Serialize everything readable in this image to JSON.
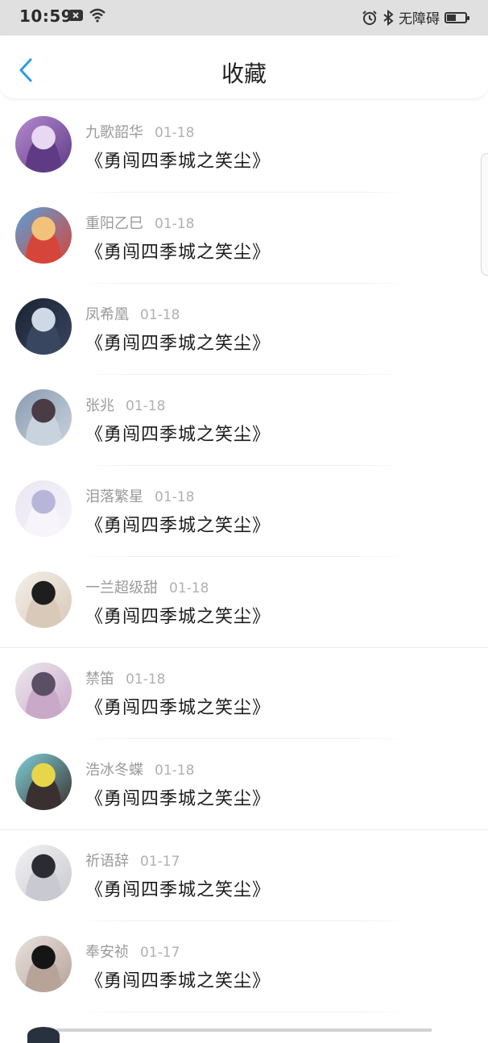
{
  "status_bar": {
    "time": "10:59",
    "right_label": "无障碍"
  },
  "header": {
    "title": "收藏",
    "back_icon": "chevron-left-icon",
    "accent_color": "#2b9ae6"
  },
  "items": [
    {
      "name": "九歌韶华",
      "date": "01-18",
      "title": "《勇闯四季城之笑尘》",
      "avatar": {
        "colors": [
          "#b58ad0",
          "#e8d8f2",
          "#5e3b84"
        ]
      }
    },
    {
      "name": "重阳乙巳",
      "date": "01-18",
      "title": "《勇闯四季城之笑尘》",
      "avatar": {
        "colors": [
          "#5aa0d8",
          "#f2c27a",
          "#d6453a"
        ]
      }
    },
    {
      "name": "凤希凰",
      "date": "01-18",
      "title": "《勇闯四季城之笑尘》",
      "avatar": {
        "colors": [
          "#1b2333",
          "#cfd8e6",
          "#394660"
        ]
      }
    },
    {
      "name": "张兆",
      "date": "01-18",
      "title": "《勇闯四季城之笑尘》",
      "avatar": {
        "colors": [
          "#8a9bb0",
          "#4a3b44",
          "#c9d3de"
        ]
      }
    },
    {
      "name": "泪落繁星",
      "date": "01-18",
      "title": "《勇闯四季城之笑尘》",
      "avatar": {
        "colors": [
          "#e9e6f3",
          "#b8b6d8",
          "#f7f4fb"
        ]
      }
    },
    {
      "name": "一兰超级甜",
      "date": "01-18",
      "title": "《勇闯四季城之笑尘》",
      "avatar": {
        "colors": [
          "#f4efe9",
          "#1e1e1e",
          "#d9c9b8"
        ]
      }
    },
    {
      "name": "禁笛",
      "date": "01-18",
      "title": "《勇闯四季城之笑尘》",
      "avatar": {
        "colors": [
          "#eee8ef",
          "#5a4f64",
          "#c9a8c8"
        ]
      }
    },
    {
      "name": "浩冰冬蝶",
      "date": "01-18",
      "title": "《勇闯四季城之笑尘》",
      "avatar": {
        "colors": [
          "#7fd0d8",
          "#e7d64a",
          "#3b3030"
        ]
      }
    },
    {
      "name": "祈语辞",
      "date": "01-17",
      "title": "《勇闯四季城之笑尘》",
      "avatar": {
        "colors": [
          "#f2f2f2",
          "#2b2b33",
          "#c9c9d2"
        ]
      }
    },
    {
      "name": "奉安祯",
      "date": "01-17",
      "title": "《勇闯四季城之笑尘》",
      "avatar": {
        "colors": [
          "#e8e2df",
          "#151515",
          "#b7a398"
        ]
      }
    }
  ]
}
